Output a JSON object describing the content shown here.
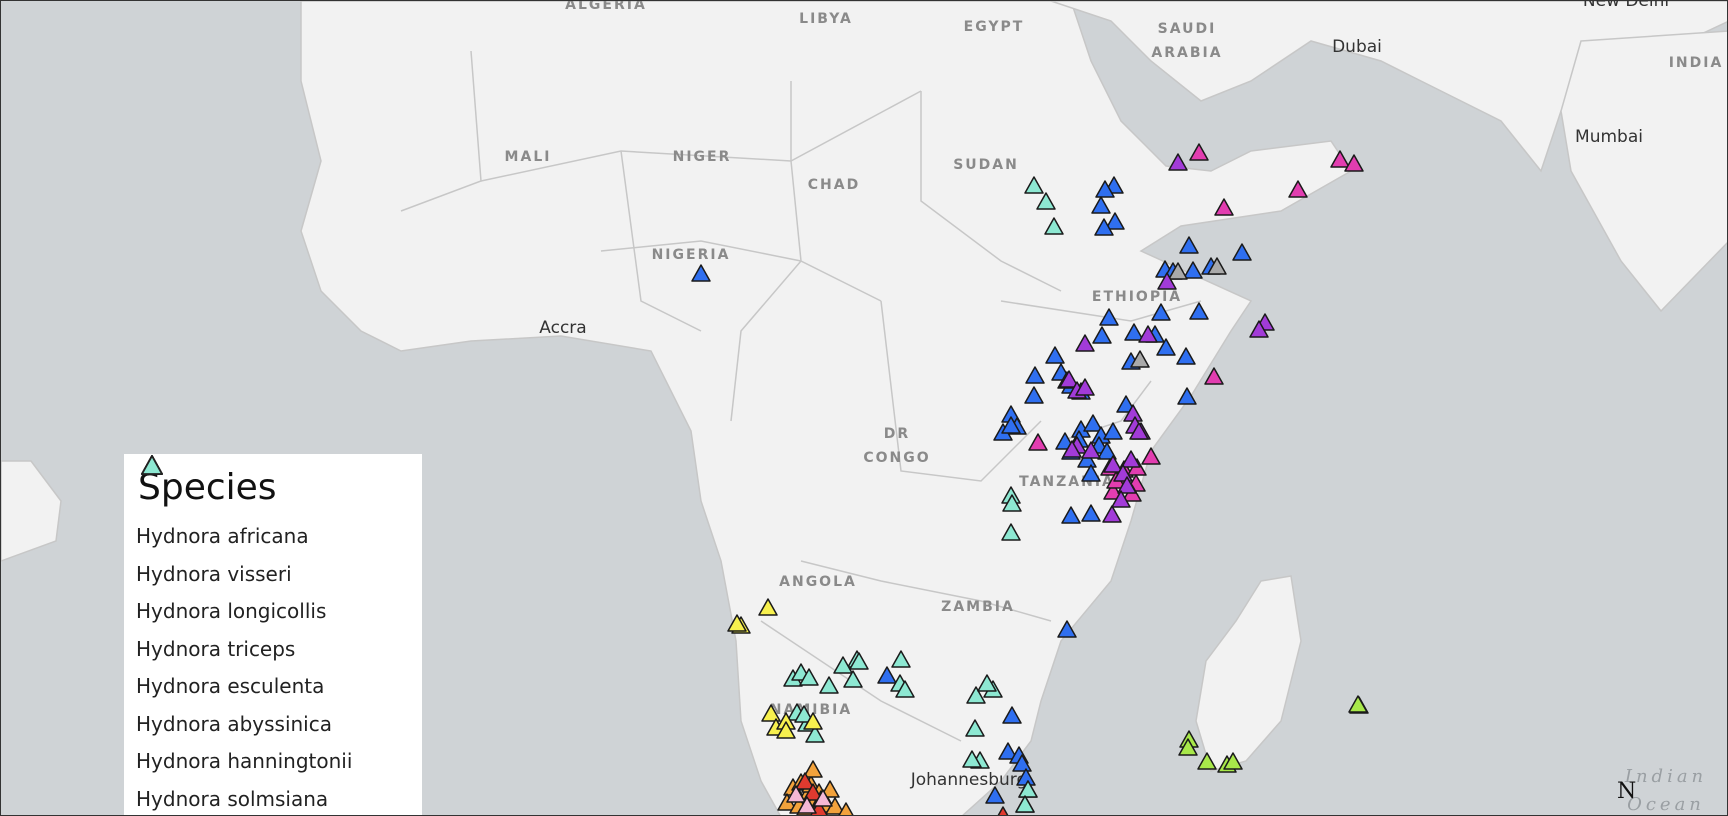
{
  "colors": {
    "ocean": "#cfd3d6",
    "land": "#f2f2f2",
    "border": "#c7c7c7"
  },
  "countries": [
    "ALGERIA",
    "LIBYA",
    "EGYPT",
    "SAUDI ARABIA",
    "INDIA",
    "MALI",
    "NIGER",
    "CHAD",
    "SUDAN",
    "NIGERIA",
    "ETHIOPIA",
    "DR CONGO",
    "TANZANIA",
    "ANGOLA",
    "ZAMBIA",
    "NAMIBIA"
  ],
  "cities": [
    "New Delhi",
    "Dubai",
    "Mumbai",
    "Accra",
    "Johannesburg"
  ],
  "ocean_label": "Indian Ocean",
  "north_arrow": "N",
  "legend": {
    "title": "Species",
    "items": [
      {
        "name": "Hydnora africana",
        "color": "#e03a2f"
      },
      {
        "name": "Hydnora visseri",
        "color": "#f2a23c"
      },
      {
        "name": "Hydnora longicollis",
        "color": "#f7f04e"
      },
      {
        "name": "Hydnora triceps",
        "color": "#f5b8d6"
      },
      {
        "name": "Hydnora esculenta",
        "color": "#a8e84a"
      },
      {
        "name": "Hydnora abyssinica",
        "color": "#2f6ff0"
      },
      {
        "name": "Hydnora hanningtonii",
        "color": "#e23db0"
      },
      {
        "name": "Hydnora solmsiana",
        "color": "#8de8d2"
      }
    ]
  }
}
